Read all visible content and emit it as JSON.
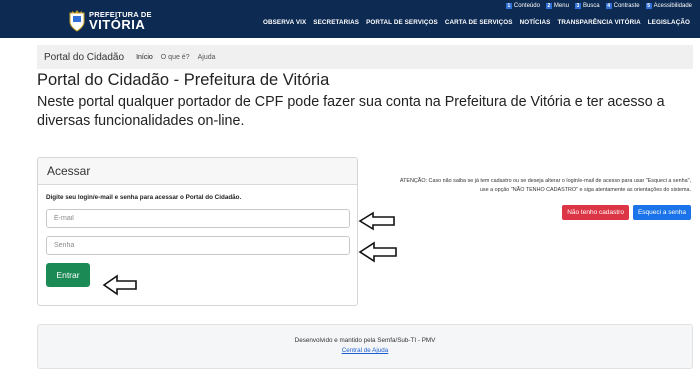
{
  "accessibility_bar": [
    {
      "key": "1",
      "label": "Conteúdo"
    },
    {
      "key": "2",
      "label": "Menu"
    },
    {
      "key": "3",
      "label": "Busca"
    },
    {
      "key": "4",
      "label": "Contraste"
    },
    {
      "key": "5",
      "label": "Acessibilidade"
    }
  ],
  "logo": {
    "line1": "PREFEITURA DE",
    "line2": "VITÓRIA"
  },
  "main_nav": [
    "OBSERVA VIX",
    "SECRETARIAS",
    "PORTAL DE SERVIÇOS",
    "CARTA DE SERVIÇOS",
    "NOTÍCIAS",
    "TRANSPARÊNCIA VITÓRIA",
    "LEGISLAÇÃO"
  ],
  "subnav": {
    "brand": "Portal do Cidadão",
    "links": [
      "Início",
      "O que é?",
      "Ajuda"
    ]
  },
  "page": {
    "title": "Portal do Cidadão - Prefeitura de Vitória",
    "subtitle": "Neste portal qualquer portador de CPF pode fazer sua conta na Prefeitura de Vitória e ter acesso a diversas funcionalidades on-line."
  },
  "login": {
    "header": "Acessar",
    "instruction": "Digite seu login/e-mail e senha para acessar o Portal do Cidadão.",
    "email_placeholder": "E-mail",
    "password_placeholder": "Senha",
    "submit_label": "Entrar"
  },
  "attention": {
    "line1": "ATENÇÃO: Caso não saiba se já tem cadastro ou se deseja alterar o login/e-mail de acesso para usar \"Esqueci a senha\",",
    "line2": "use a opção \"NÃO TENHO CADASTRO\" e siga atentamente as orientações do sistema.",
    "btn_no_account": "Não tenho cadastro",
    "btn_forgot": "Esqueci a senha"
  },
  "footer": {
    "text": "Desenvolvido e mantido pela Semfa/Sub-TI - PMV",
    "link": "Central de Ajuda"
  },
  "colors": {
    "header_bg": "#0d2a52",
    "primary_green": "#1c8a55",
    "danger": "#dc3545",
    "primary_blue": "#1a73e8"
  }
}
